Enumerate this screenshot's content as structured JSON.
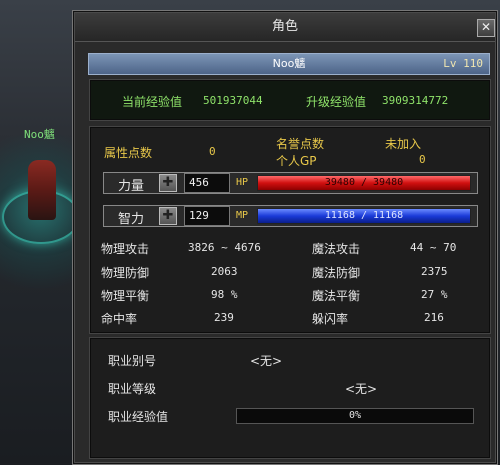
{
  "world": {
    "character_name": "Noo魑"
  },
  "window": {
    "title": "角色",
    "close_label": "✕"
  },
  "namebar": {
    "name": "Noo魑",
    "level": "Lv 110"
  },
  "experience": {
    "current_label": "当前经验值",
    "current_value": "501937044",
    "next_label": "升级经验值",
    "next_value": "3909314772"
  },
  "attributes": {
    "points_label": "属性点数",
    "points_value": "0",
    "honor_label": "名誉点数",
    "honor_value": "未加入",
    "gp_label": "个人GP",
    "gp_value": "0"
  },
  "strength": {
    "label": "力量",
    "plus_label": "✚",
    "value": "456",
    "bar_label": "HP",
    "bar_text": "39480 / 39480",
    "color": "#d11010"
  },
  "intellect": {
    "label": "智力",
    "plus_label": "✚",
    "value": "129",
    "bar_label": "MP",
    "bar_text": "11168 / 11168",
    "color": "#1a3ad8"
  },
  "combat": [
    {
      "label": "物理攻击",
      "value": "3826 ~ 4676",
      "label2": "魔法攻击",
      "value2": "44 ~ 70"
    },
    {
      "label": "物理防御",
      "value": "2063",
      "label2": "魔法防御",
      "value2": "2375"
    },
    {
      "label": "物理平衡",
      "value": "98 %",
      "label2": "魔法平衡",
      "value2": "27 %"
    },
    {
      "label": "命中率",
      "value": "239",
      "label2": "躲闪率",
      "value2": "216"
    }
  ],
  "job": {
    "id_label": "职业别号",
    "id_value": "<无>",
    "level_label": "职业等级",
    "level_value": "<无>",
    "exp_label": "职业经验值",
    "exp_value": "0%",
    "exp_fraction": 0
  }
}
